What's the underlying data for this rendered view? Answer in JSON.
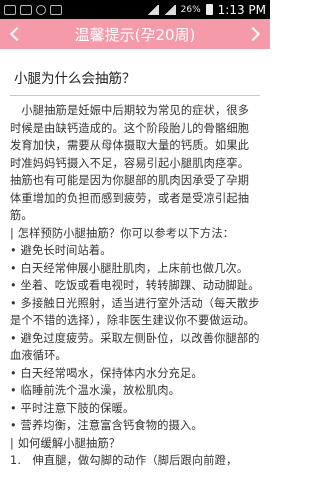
{
  "status_bar": {
    "battery_pct": "26%",
    "time": "1:13 PM"
  },
  "app_bar": {
    "title": "温馨提示(孕20周)"
  },
  "article": {
    "heading": "小腿为什么会抽筋？",
    "paragraphs": [
      "　小腿抽筋是妊娠中后期较为常见的症状，很多时候是由缺钙造成的。这个阶段胎儿的骨骼细胞发育加快，需要从母体摄取大量的钙质。如果此时准妈妈钙摄入不足，容易引起小腿肌肉痉挛。抽筋也有可能是因为你腿部的肌肉因承受了孕期体重增加的负担而感到疲劳，或者是受凉引起抽筋。",
      "| 怎样预防小腿抽筋？你可以参考以下方法：",
      "• 避免长时间站着。",
      "• 白天经常伸展小腿肚肌肉，上床前也做几次。",
      "• 坐着、吃饭或看电视时，转转脚踝、动动脚趾。",
      "• 多接触日光照射，适当进行室外活动（每天散步是个不错的选择），除非医生建议你不要做运动。",
      "• 避免过度疲劳。采取左侧卧位，以改善你腿部的血液循环。",
      "• 白天经常喝水，保持体内水分充足。",
      "• 临睡前洗个温水澡，放松肌肉。",
      "• 平时注意下肢的保暖。",
      "• 营养均衡，注意富含钙食物的摄入。",
      "| 如何缓解小腿抽筋？",
      "1.　伸直腿，做勾脚的动作（脚后跟向前蹬，"
    ]
  }
}
